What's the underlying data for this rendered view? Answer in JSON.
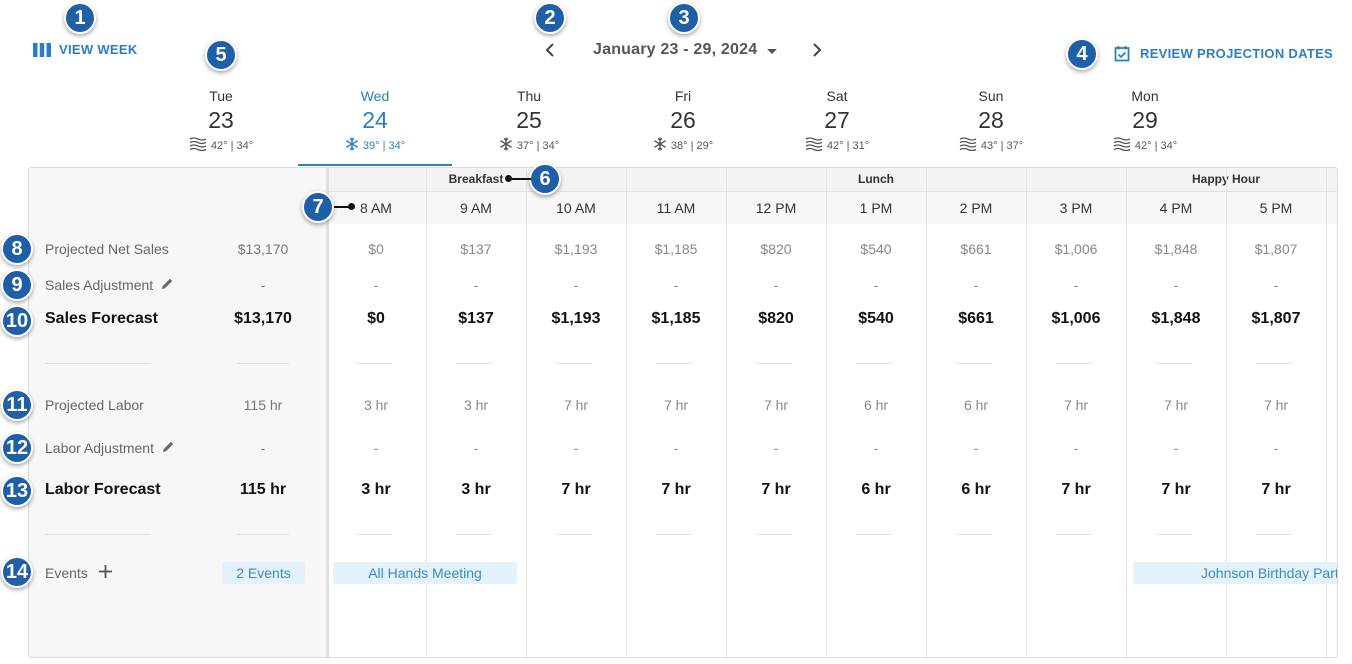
{
  "header": {
    "view_week_label": "VIEW WEEK",
    "date_range": "January 23 - 29, 2024",
    "review_label": "REVIEW PROJECTION DATES"
  },
  "days": [
    {
      "dow": "Tue",
      "num": "23",
      "weather": "42° | 34°",
      "icon": "fog-icon",
      "active": false
    },
    {
      "dow": "Wed",
      "num": "24",
      "weather": "39° | 34°",
      "icon": "snow-icon",
      "active": true
    },
    {
      "dow": "Thu",
      "num": "25",
      "weather": "37° | 34°",
      "icon": "snow-icon",
      "active": false
    },
    {
      "dow": "Fri",
      "num": "26",
      "weather": "38° | 29°",
      "icon": "snow-icon",
      "active": false
    },
    {
      "dow": "Sat",
      "num": "27",
      "weather": "42° | 31°",
      "icon": "fog-icon",
      "active": false
    },
    {
      "dow": "Sun",
      "num": "28",
      "weather": "43° | 37°",
      "icon": "fog-icon",
      "active": false
    },
    {
      "dow": "Mon",
      "num": "29",
      "weather": "42° | 34°",
      "icon": "fog-icon",
      "active": false
    }
  ],
  "dayparts": [
    "Breakfast",
    "Lunch",
    "Happy Hour"
  ],
  "hours": [
    "8 AM",
    "9 AM",
    "10 AM",
    "11 AM",
    "12 PM",
    "1 PM",
    "2 PM",
    "3 PM",
    "4 PM",
    "5 PM"
  ],
  "rows": {
    "projected_net_sales": {
      "label": "Projected Net Sales",
      "total": "$13,170",
      "values": [
        "$0",
        "$137",
        "$1,193",
        "$1,185",
        "$820",
        "$540",
        "$661",
        "$1,006",
        "$1,848",
        "$1,807"
      ]
    },
    "sales_adjustment": {
      "label": "Sales Adjustment",
      "total": "-",
      "values": [
        "-",
        "-",
        "-",
        "-",
        "-",
        "-",
        "-",
        "-",
        "-",
        "-"
      ]
    },
    "sales_forecast": {
      "label": "Sales Forecast",
      "total": "$13,170",
      "values": [
        "$0",
        "$137",
        "$1,193",
        "$1,185",
        "$820",
        "$540",
        "$661",
        "$1,006",
        "$1,848",
        "$1,807"
      ]
    },
    "projected_labor": {
      "label": "Projected Labor",
      "total": "115 hr",
      "values": [
        "3 hr",
        "3 hr",
        "7 hr",
        "7 hr",
        "7 hr",
        "6 hr",
        "6 hr",
        "7 hr",
        "7 hr",
        "7 hr"
      ]
    },
    "labor_adjustment": {
      "label": "Labor Adjustment",
      "total": "-",
      "values": [
        "-",
        "-",
        "-",
        "-",
        "-",
        "-",
        "-",
        "-",
        "-",
        "-"
      ]
    },
    "labor_forecast": {
      "label": "Labor Forecast",
      "total": "115 hr",
      "values": [
        "3 hr",
        "3 hr",
        "7 hr",
        "7 hr",
        "7 hr",
        "6 hr",
        "6 hr",
        "7 hr",
        "7 hr",
        "7 hr"
      ]
    }
  },
  "events": {
    "label": "Events",
    "count_badge": "2 Events",
    "items": [
      "All Hands Meeting",
      "Johnson Birthday Party"
    ]
  },
  "callouts": [
    "1",
    "2",
    "3",
    "4",
    "5",
    "6",
    "7",
    "8",
    "9",
    "10",
    "11",
    "12",
    "13",
    "14"
  ],
  "colors": {
    "accent": "#2b7fc1",
    "callout": "#1f5fa8",
    "chip": "#e3f2fb"
  }
}
